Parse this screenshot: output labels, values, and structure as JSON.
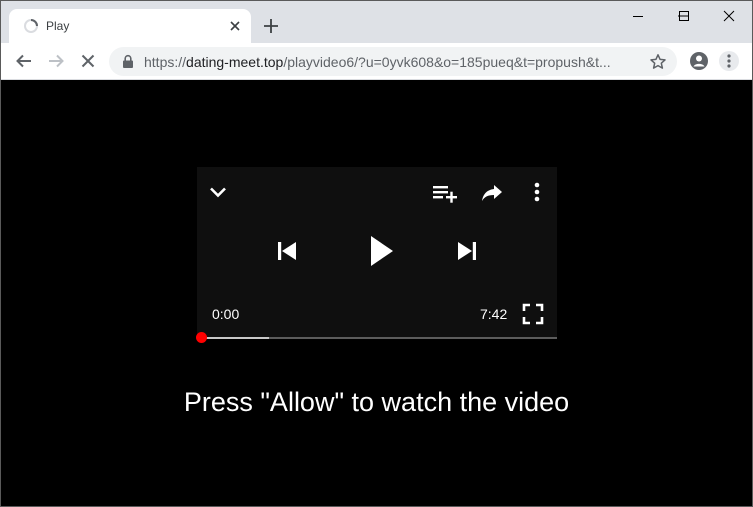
{
  "browser": {
    "tab_title": "Play",
    "url_prefix": "https://",
    "url_host": "dating-meet.top",
    "url_rest": "/playvideo6/?u=0yvk608&o=185pueq&t=propush&t..."
  },
  "player": {
    "current_time": "0:00",
    "duration": "7:42",
    "progress_fraction": 0.0,
    "buffered_fraction": 0.19
  },
  "page": {
    "message": "Press \"Allow\" to watch the video"
  },
  "colors": {
    "progress_dot": "#ff0000",
    "tabstrip": "#dee1e6",
    "page_bg": "#000000"
  }
}
